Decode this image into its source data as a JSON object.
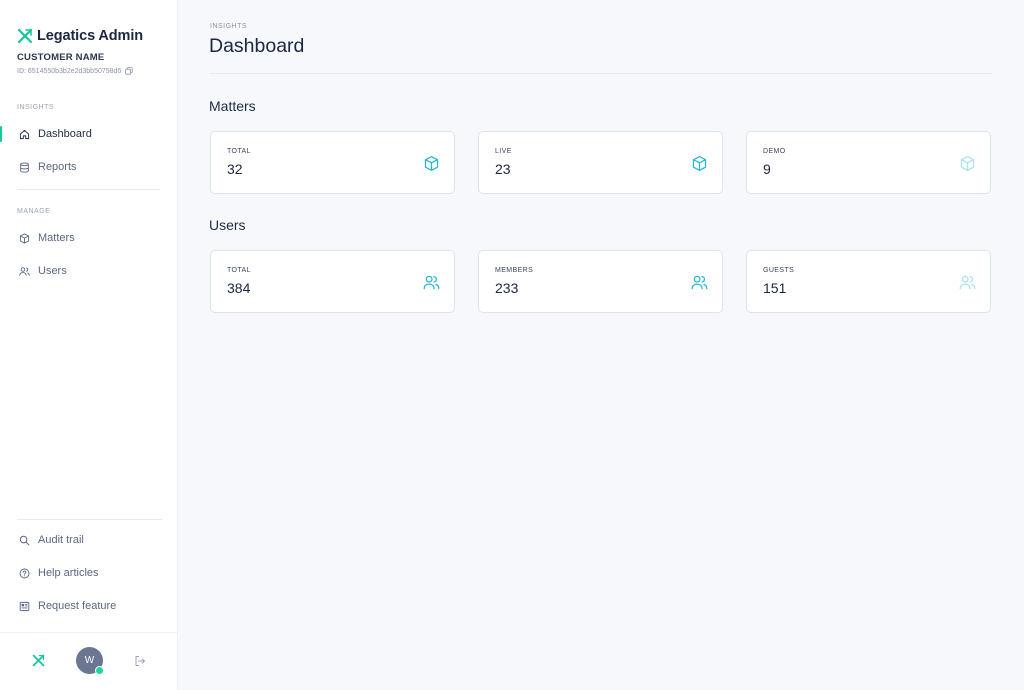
{
  "brand": {
    "name": "Legatics Admin"
  },
  "customer": {
    "name": "CUSTOMER NAME",
    "id": "ID: 6514550b3b2e2d3bb50758d6"
  },
  "sidebar": {
    "insights_label": "INSIGHTS",
    "manage_label": "MANAGE",
    "items": {
      "dashboard": "Dashboard",
      "reports": "Reports",
      "matters": "Matters",
      "users": "Users",
      "audit_trail": "Audit trail",
      "help_articles": "Help articles",
      "request_feature": "Request feature"
    },
    "active_item": "dashboard"
  },
  "footer": {
    "avatar_initial": "W",
    "status": "online"
  },
  "main": {
    "crumb": "INSIGHTS",
    "title": "Dashboard",
    "matters": {
      "title": "Matters",
      "cards": [
        {
          "label": "TOTAL",
          "value": "32",
          "icon": "box-icon"
        },
        {
          "label": "LIVE",
          "value": "23",
          "icon": "box-icon"
        },
        {
          "label": "DEMO",
          "value": "9",
          "icon": "box-icon"
        }
      ]
    },
    "users": {
      "title": "Users",
      "cards": [
        {
          "label": "TOTAL",
          "value": "384",
          "icon": "users-icon"
        },
        {
          "label": "MEMBERS",
          "value": "233",
          "icon": "users-icon"
        },
        {
          "label": "GUESTS",
          "value": "151",
          "icon": "users-icon"
        }
      ]
    }
  },
  "colors": {
    "accent": "#13c89a",
    "icon_primary": "#22b8d6",
    "icon_muted": "#a8e2ee",
    "sidebar_text": "#5b6680",
    "heading": "#1c2742"
  }
}
